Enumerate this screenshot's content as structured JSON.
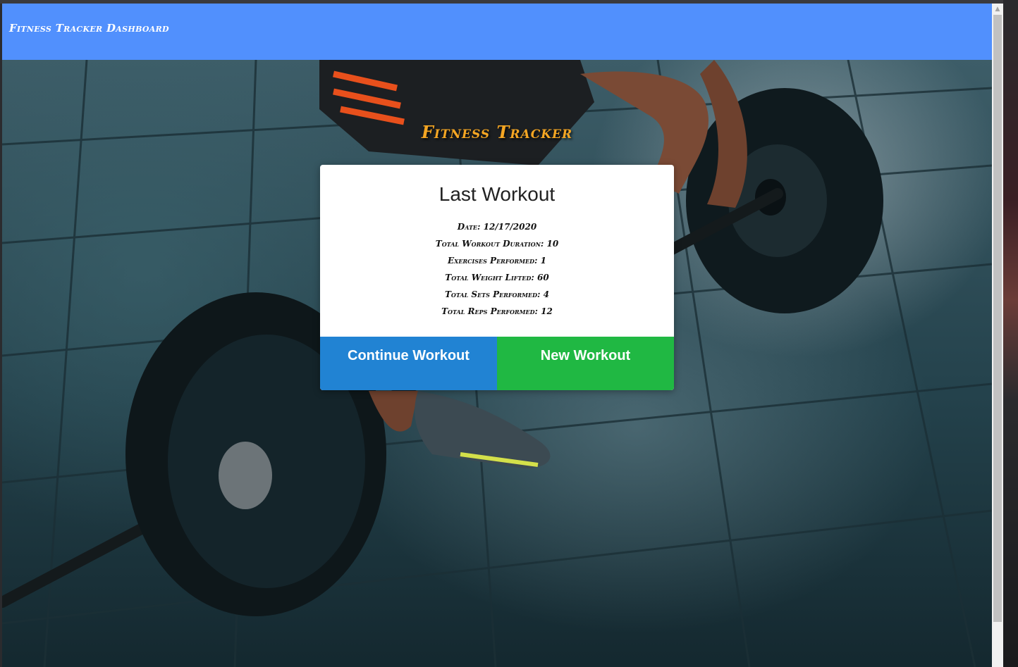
{
  "navbar": {
    "brand": "Fitness Tracker Dashboard"
  },
  "hero": {
    "title": "Fitness Tracker"
  },
  "card": {
    "title": "Last Workout",
    "stats": [
      "Date: 12/17/2020",
      "Total Workout Duration: 10",
      "Exercises Performed: 1",
      "Total Weight Lifted: 60",
      "Total Sets Performed: 4",
      "Total Reps Performed: 12"
    ],
    "continue_label": "Continue Workout",
    "new_label": "New Workout"
  },
  "colors": {
    "navbar": "#5190fd",
    "hero_title": "#f5a623",
    "continue_button": "#2183d3",
    "new_button": "#20b843"
  },
  "icons": {
    "scroll_up": "chevron-up-icon"
  }
}
